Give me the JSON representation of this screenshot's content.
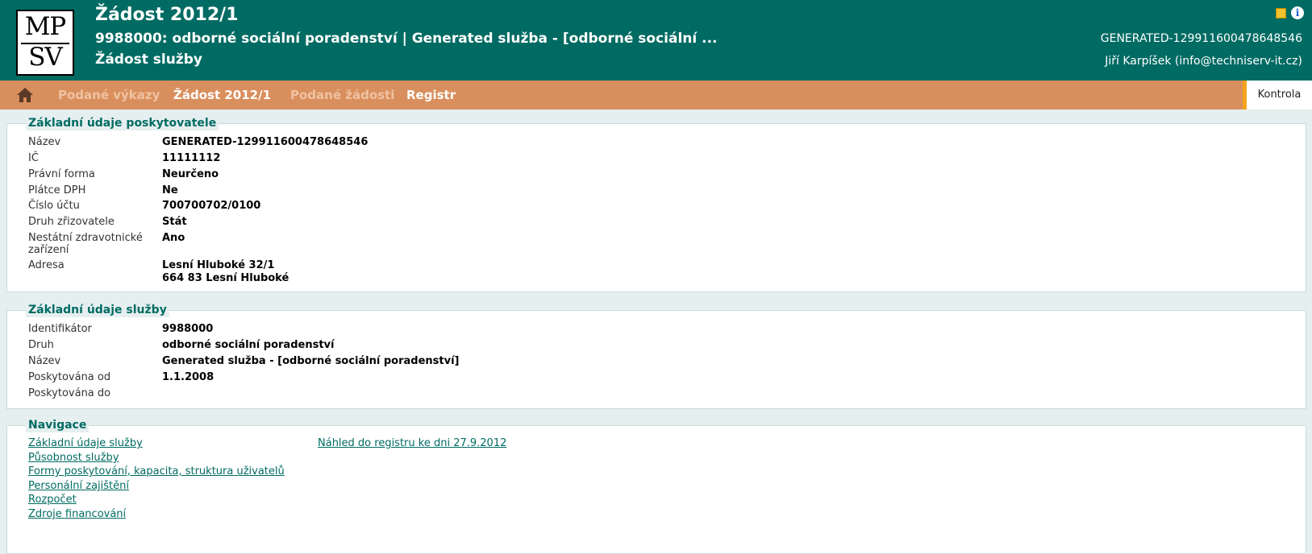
{
  "header": {
    "logo_top": "MP",
    "logo_bottom": "SV",
    "title": "Žádost 2012/1",
    "subtitle": "9988000: odborné sociální poradenství | Generated služba - [odborné sociální ...",
    "subtitle2": "Žádost služby",
    "code": "GENERATED-129911600478648546",
    "user": "Jiří Karpíšek   (info@techniserv-it.cz)",
    "icons": [
      "note-icon",
      "info-icon"
    ]
  },
  "menu": {
    "items": [
      {
        "label": "Podané výkazy",
        "state": "dim"
      },
      {
        "label": "Žádost 2012/1",
        "state": "active"
      },
      {
        "label": "Podané žádosti",
        "state": "dim"
      },
      {
        "label": "Registr",
        "state": "active"
      }
    ],
    "kontrola": "Kontrola"
  },
  "provider": {
    "legend": "Základní údaje poskytovatele",
    "rows": [
      {
        "label": "Název",
        "value": "GENERATED-129911600478648546"
      },
      {
        "label": "IČ",
        "value": "11111112"
      },
      {
        "label": "Právní forma",
        "value": "Neurčeno"
      },
      {
        "label": "Plátce DPH",
        "value": "Ne"
      },
      {
        "label": "Číslo účtu",
        "value": "700700702/0100"
      },
      {
        "label": "Druh zřizovatele",
        "value": "Stát"
      },
      {
        "label": "Nestátní zdravotnické",
        "label2": "zařízení",
        "value": "Ano"
      },
      {
        "label": "Adresa",
        "value": "Lesní Hluboké 32/1",
        "value2": "664 83 Lesní Hluboké"
      }
    ]
  },
  "service": {
    "legend": "Základní údaje služby",
    "rows": [
      {
        "label": "Identifikátor",
        "value": "9988000"
      },
      {
        "label": "Druh",
        "value": "odborné sociální poradenství"
      },
      {
        "label": "Název",
        "value": "Generated služba - [odborné sociální poradenství]"
      },
      {
        "label": "Poskytována od",
        "value": "1.1.2008"
      },
      {
        "label": "Poskytována do",
        "value": ""
      }
    ]
  },
  "navigation": {
    "legend": "Navigace",
    "links": [
      "Základní údaje služby",
      "Působnost služby",
      "Formy poskytování, kapacita, struktura uživatelů",
      "Personální zajištění",
      "Rozpočet",
      "Zdroje financování"
    ],
    "preview": "Náhled do registru ke dni 27.9.2012"
  },
  "colors": {
    "header_bg": "#006b63",
    "menu_bg": "#d98f5d",
    "accent": "#f7a21b",
    "link": "#006b63"
  }
}
